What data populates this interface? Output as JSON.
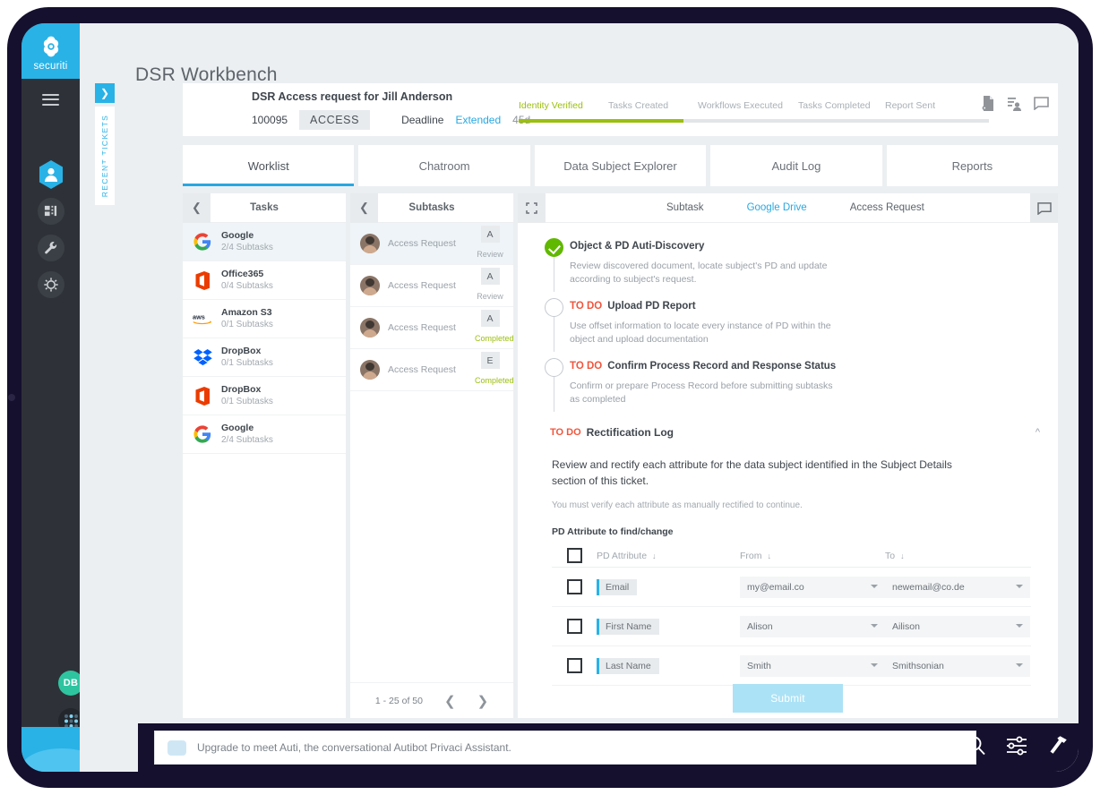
{
  "brand": {
    "name": "securiti",
    "logo_icon": "securiti-logo-icon"
  },
  "left_nav": {
    "menu_icon": "hamburger-icon",
    "items": [
      {
        "icon": "privacy-hex-icon",
        "name": "privacy-center"
      },
      {
        "icon": "dashboard-icon",
        "name": "dashboard"
      },
      {
        "icon": "wrench-icon",
        "name": "tools"
      },
      {
        "icon": "settings-gear-icon",
        "name": "settings"
      }
    ],
    "avatar_initials": "DB",
    "apps_icon": "apps-grid-icon"
  },
  "header": {
    "title": "DSR Workbench"
  },
  "rail": {
    "expand_label": "❯",
    "label": "RECENT TICKETS"
  },
  "ticket": {
    "title": "DSR Access request for Jill Anderson",
    "id": "100095",
    "type": "ACCESS",
    "deadline_label": "Deadline",
    "deadline_status": "Extended",
    "deadline_days": "45d",
    "progress_percent": 35,
    "steps": [
      {
        "label": "Identity Verified",
        "done": true
      },
      {
        "label": "Tasks Created",
        "done": false
      },
      {
        "label": "Workflows Executed",
        "done": false
      },
      {
        "label": "Tasks Completed",
        "done": false
      },
      {
        "label": "Report Sent",
        "done": false
      }
    ],
    "actions": [
      {
        "icon": "document-add-icon",
        "name": "attach-document"
      },
      {
        "icon": "assign-user-icon",
        "name": "assign-user"
      },
      {
        "icon": "comment-icon",
        "name": "comments"
      }
    ],
    "accent_green": "#9bbf0d",
    "accent_blue": "#29a8e0"
  },
  "tabs": [
    {
      "label": "Worklist",
      "active": true
    },
    {
      "label": "Chatroom",
      "active": false
    },
    {
      "label": "Data Subject Explorer",
      "active": false
    },
    {
      "label": "Audit Log",
      "active": false
    },
    {
      "label": "Reports",
      "active": false
    }
  ],
  "tasks_panel": {
    "title": "Tasks",
    "back_icon": "chevron-left-icon",
    "items": [
      {
        "name": "Google",
        "subtasks": "2/4 Subtasks",
        "icon": "google-icon",
        "selected": true
      },
      {
        "name": "Office365",
        "subtasks": "0/4 Subtasks",
        "icon": "office365-icon",
        "selected": false
      },
      {
        "name": "Amazon S3",
        "subtasks": "0/1 Subtasks",
        "icon": "aws-icon",
        "selected": false
      },
      {
        "name": "DropBox",
        "subtasks": "0/1 Subtasks",
        "icon": "dropbox-icon",
        "selected": false
      },
      {
        "name": "DropBox",
        "subtasks": "0/1 Subtasks",
        "icon": "office365-icon",
        "selected": false
      },
      {
        "name": "Google",
        "subtasks": "2/4 Subtasks",
        "icon": "google-icon",
        "selected": false
      }
    ]
  },
  "subtasks_panel": {
    "title": "Subtasks",
    "back_icon": "chevron-left-icon",
    "items": [
      {
        "name": "Access Request",
        "badge": "A",
        "status": "Review",
        "completed": false,
        "selected": true
      },
      {
        "name": "Access Request",
        "badge": "A",
        "status": "Review",
        "completed": false,
        "selected": false
      },
      {
        "name": "Access Request",
        "badge": "A",
        "status": "Completed",
        "completed": true,
        "selected": false
      },
      {
        "name": "Access Request",
        "badge": "E",
        "status": "Completed",
        "completed": true,
        "selected": false
      }
    ],
    "pager": {
      "range": "1 - 25 of 50",
      "prev_icon": "chevron-left-icon",
      "next_icon": "chevron-right-icon"
    }
  },
  "detail": {
    "expand_icon": "expand-icon",
    "comment_icon": "comment-icon",
    "breadcrumb": {
      "subtask": "Subtask",
      "source": "Google Drive",
      "type": "Access Request"
    },
    "steps": [
      {
        "title": "Object & PD Auti-Discovery",
        "todo": "",
        "description": "Review discovered document, locate subject's PD and update according to subject's request.",
        "done": true
      },
      {
        "title": "Upload PD Report",
        "todo": "TO DO",
        "description": "Use offset information to locate every instance of PD within the object and upload documentation",
        "done": false
      },
      {
        "title": "Confirm Process Record and Response Status",
        "todo": "TO DO",
        "description": "Confirm or prepare Process Record before submitting subtasks as completed",
        "done": false
      }
    ],
    "rectification": {
      "todo": "TO DO",
      "title": "Rectification Log",
      "collapse_icon": "chevron-up-icon",
      "lead": "Review and rectify each attribute for the data subject identified in the Subject Details section of this ticket.",
      "note": "You must verify each attribute as manually rectified to continue.",
      "section_label": "PD Attribute to find/change",
      "columns": [
        {
          "label": "PD Attribute",
          "sort_icon": "↓"
        },
        {
          "label": "From",
          "sort_icon": "↓"
        },
        {
          "label": "To",
          "sort_icon": "↓"
        }
      ],
      "rows": [
        {
          "attribute": "Email",
          "from": "my@email.co",
          "to": "newemail@co.de",
          "checked": false
        },
        {
          "attribute": "First Name",
          "from": "Alison",
          "to": "Ailison",
          "checked": false
        },
        {
          "attribute": "Last Name",
          "from": "Smith",
          "to": "Smithsonian",
          "checked": false
        }
      ],
      "select_all_checked": false
    },
    "submit_label": "Submit"
  },
  "bottom_bar": {
    "chat_placeholder": "Upgrade to meet Auti, the conversational Autibot Privaci Assistant.",
    "chat_icon": "chat-bubble-icon",
    "actions": [
      {
        "icon": "search-icon",
        "name": "search"
      },
      {
        "icon": "filter-sliders-icon",
        "name": "filters"
      },
      {
        "icon": "hammer-tools-icon",
        "name": "tools"
      }
    ]
  }
}
